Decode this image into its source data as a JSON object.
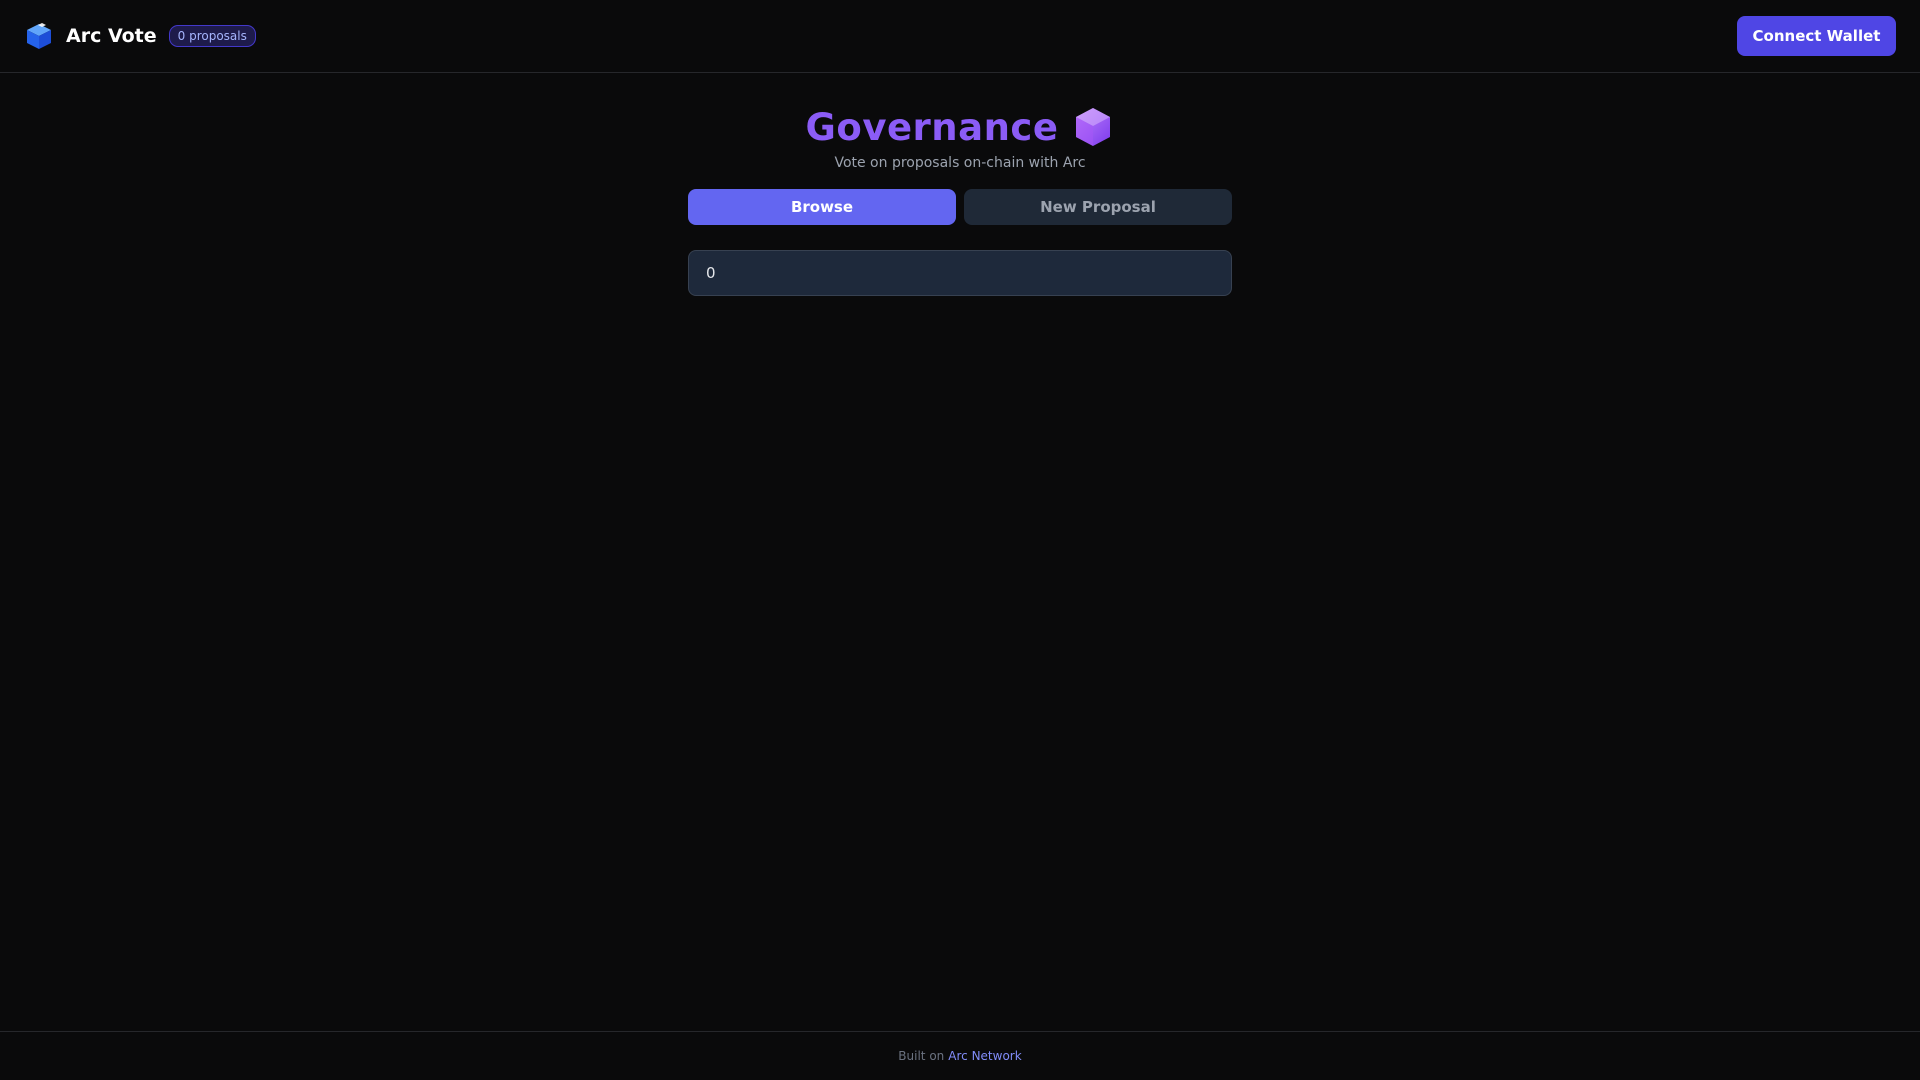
{
  "header": {
    "app_title": "Arc Vote",
    "proposal_badge": "0 proposals",
    "connect_label": "Connect Wallet"
  },
  "main": {
    "title": "Governance",
    "subtitle": "Vote on proposals on-chain with Arc",
    "tabs": [
      {
        "label": "Browse",
        "active": true
      },
      {
        "label": "New Proposal",
        "active": false
      }
    ],
    "search_value": "0"
  },
  "footer": {
    "prefix": "Built on",
    "link_label": "Arc Network"
  },
  "icons": {
    "logo": "cube-icon",
    "title": "hexagon-icon"
  },
  "colors": {
    "accent": "#6366f1",
    "connect_button": "#4f46e5",
    "title": "#8b5cf6",
    "background": "#0a0a0b"
  }
}
